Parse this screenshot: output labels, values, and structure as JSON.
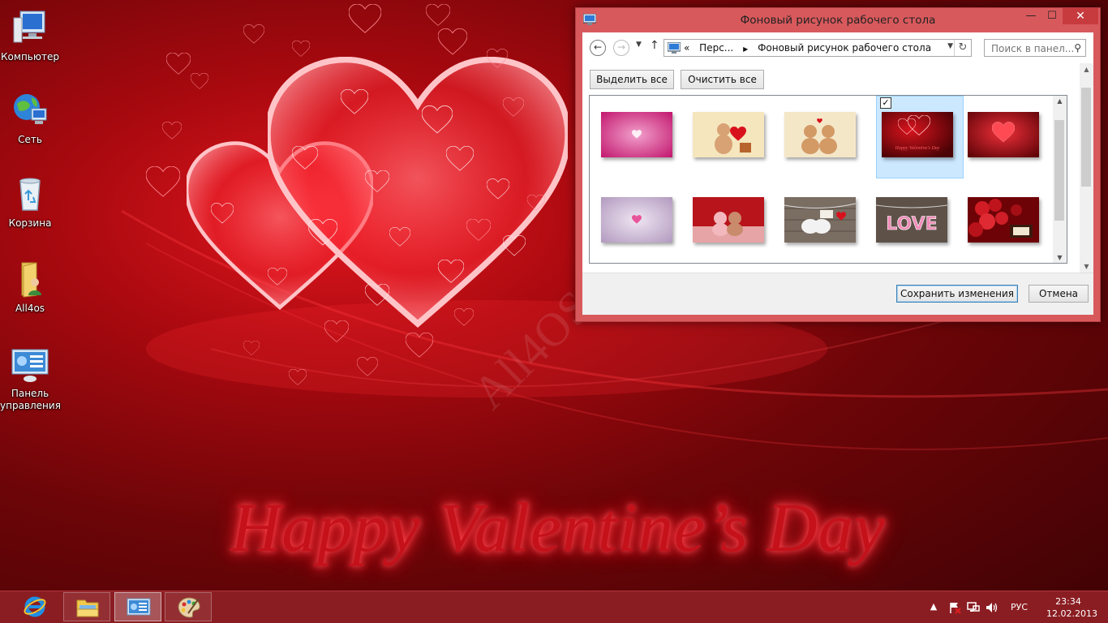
{
  "desktop": {
    "icons": [
      {
        "label": "Компьютер"
      },
      {
        "label": "Сеть"
      },
      {
        "label": "Корзина"
      },
      {
        "label": "All4os"
      },
      {
        "label": "Панель управления"
      }
    ],
    "wallpaper_text": "Happy Valentine’s Day",
    "watermark": "All4OS.RU"
  },
  "window": {
    "title": "Фоновый рисунок рабочего стола",
    "controls": {
      "minimize": "—",
      "maximize": "☐",
      "close": "✕"
    },
    "address": {
      "overflow": "«",
      "crumbs": [
        "Перс...",
        "Фоновый рисунок рабочего стола"
      ]
    },
    "search": {
      "placeholder": "Поиск в панел..."
    },
    "buttons": {
      "select_all": "Выделить все",
      "clear_all": "Очистить все",
      "save": "Сохранить изменения",
      "cancel": "Отмена"
    },
    "gallery": {
      "selected_index": 3,
      "thumbnails": [
        {
          "colors": [
            "#c2176e",
            "#e86aaa"
          ],
          "selected": false
        },
        {
          "colors": [
            "#f5e6bd",
            "#c98a5a"
          ],
          "selected": false
        },
        {
          "colors": [
            "#f4e7c8",
            "#c79a6a"
          ],
          "selected": false
        },
        {
          "colors": [
            "#5a0206",
            "#c1121b"
          ],
          "selected": true,
          "caption": "Happy Valentine's Day"
        },
        {
          "colors": [
            "#5e0307",
            "#e2262e"
          ],
          "selected": false
        },
        {
          "colors": [
            "#bca6c8",
            "#ede2f0"
          ],
          "selected": false
        },
        {
          "colors": [
            "#a0131a",
            "#e7a4a6"
          ],
          "selected": false
        },
        {
          "colors": [
            "#6e6258",
            "#b7aa9e"
          ],
          "selected": false
        },
        {
          "colors": [
            "#5e5148",
            "#e88fb3"
          ],
          "selected": false,
          "caption": "LOVE"
        },
        {
          "colors": [
            "#780409",
            "#ce2129"
          ],
          "selected": false
        }
      ]
    }
  },
  "taskbar": {
    "apps": [
      "internet-explorer",
      "file-explorer",
      "control-panel",
      "paint"
    ],
    "language": "РУС",
    "time": "23:34",
    "date": "12.02.2013"
  },
  "colors": {
    "window_frame": "#d8595c",
    "taskbar": "#8a1d22",
    "wallpaper_base": "#8a0a10",
    "selection": "#cce8ff"
  }
}
